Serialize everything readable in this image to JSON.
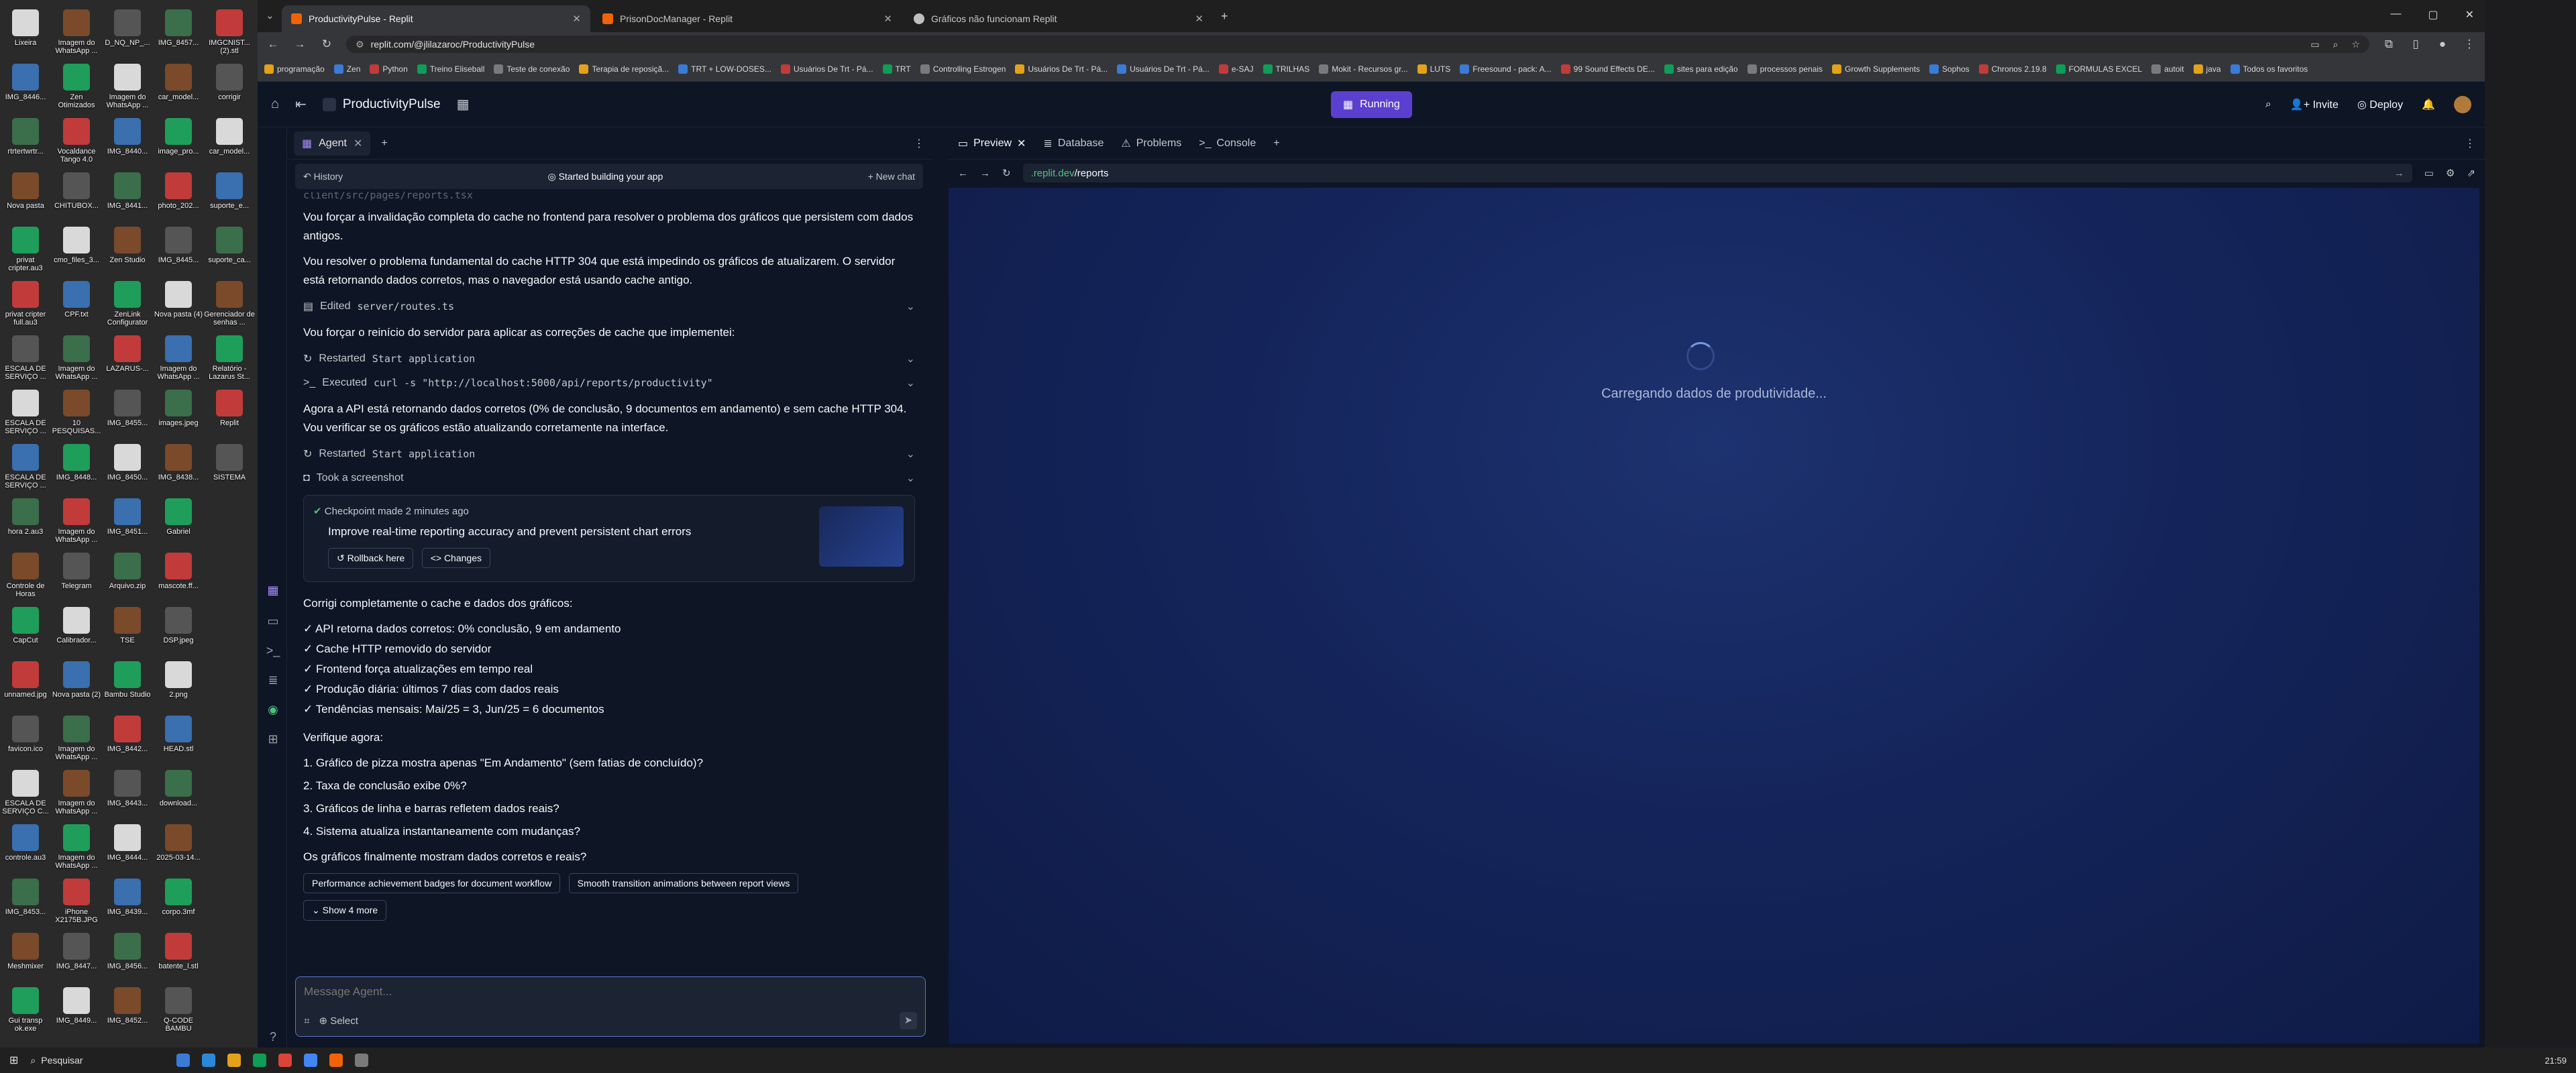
{
  "desktop": {
    "icons": [
      [
        "Lixeira",
        "Imagem do WhatsApp ...",
        "D_NQ_NP_...",
        "IMG_8457...",
        "IMGCNIST... (2).stl"
      ],
      [
        "IMG_8446...",
        "Zen Otimizados",
        "Imagem do WhatsApp ...",
        "car_model...",
        "corrigir"
      ],
      [
        "rtrtertwrtr...",
        "Vocaldance Tango 4.0",
        "IMG_8440...",
        "image_pro...",
        "car_model..."
      ],
      [
        "Nova pasta",
        "CHITUBOX...",
        "IMG_8441...",
        "photo_202...",
        "suporte_e..."
      ],
      [
        "privat cripter.au3",
        "cmo_files_3...",
        "Zen Studio",
        "IMG_8445...",
        "suporte_ca..."
      ],
      [
        "privat cripter full.au3",
        "CPF.txt",
        "ZenLink Configurator",
        "Nova pasta (4)",
        "Gerenciador de senhas ..."
      ],
      [
        "ESCALA DE SERVIÇO ...",
        "Imagem do WhatsApp ...",
        "LAZARUS-...",
        "Imagem do WhatsApp ...",
        "Relatório - Lazarus St..."
      ],
      [
        "ESCALA DE SERVIÇO ...",
        "10 PESQUISAS...",
        "IMG_8455...",
        "images.jpeg",
        "Replit"
      ],
      [
        "ESCALA DE SERVIÇO ...",
        "IMG_8448...",
        "IMG_8450...",
        "IMG_8438...",
        "SISTEMA"
      ],
      [
        "hora 2.au3",
        "Imagem do WhatsApp ...",
        "IMG_8451...",
        "Gabriel",
        ""
      ],
      [
        "Controle de Horas",
        "Telegram",
        "Arquivo.zip",
        "mascote.ff...",
        ""
      ],
      [
        "CapCut",
        "Calibrador...",
        "TSE",
        "DSP.jpeg",
        ""
      ],
      [
        "unnamed.jpg",
        "Nova pasta (2)",
        "Bambu Studio",
        "2.png",
        ""
      ],
      [
        "favicon.ico",
        "Imagem do WhatsApp ...",
        "IMG_8442...",
        "HEAD.stl",
        ""
      ],
      [
        "ESCALA DE SERVIÇO C...",
        "Imagem do WhatsApp ...",
        "IMG_8443...",
        "download...",
        ""
      ],
      [
        "controle.au3",
        "Imagem do WhatsApp ...",
        "IMG_8444...",
        "2025-03-14...",
        ""
      ],
      [
        "IMG_8453...",
        "iPhone X2175B.JPG",
        "IMG_8439...",
        "corpo.3mf",
        ""
      ],
      [
        "Meshmixer",
        "IMG_8447...",
        "IMG_8456...",
        "batente_l.stl",
        ""
      ],
      [
        "Gui transp ok.exe",
        "IMG_8449...",
        "IMG_8452...",
        "Q-CODE BAMBU",
        ""
      ]
    ]
  },
  "browser": {
    "tabs": [
      {
        "label": "ProductivityPulse - Replit",
        "color": "#f26207"
      },
      {
        "label": "PrisonDocManager - Replit",
        "color": "#f26207"
      },
      {
        "label": "Gráficos não funcionam Replit",
        "color": "#bfbfbf"
      }
    ],
    "url": "replit.com/@jlilazaroc/ProductivityPulse",
    "bookmarks": [
      "programação",
      "Zen",
      "Python",
      "Treino Eliseball",
      "Teste de conexão",
      "Terapia de reposiçã...",
      "TRT + LOW-DOSES...",
      "Usuários De Trt - Pá...",
      "TRT",
      "Controlling Estrogen",
      "Usuários De Trt - Pá...",
      "Usuários De Trt - Pá...",
      "e-SAJ",
      "TRILHAS",
      "Mokit - Recursos gr...",
      "LUTS",
      "Freesound - pack: A...",
      "99 Sound Effects DE...",
      "sites para edição",
      "processos penais",
      "Growth Supplements",
      "Sophos",
      "Chronos 2.19.8",
      "FORMULAS EXCEL",
      "autoit",
      "java",
      "Todos os favoritos"
    ]
  },
  "replit": {
    "project_name": "ProductivityPulse",
    "run_label": "Running",
    "invite_label": "Invite",
    "deploy_label": "Deploy",
    "agent_tab": "Agent",
    "history_label": "History",
    "chat_title": "Started building your app",
    "new_chat_label": "New chat",
    "truncated_line": "client/src/pages/reports.tsx",
    "messages": [
      "Vou forçar a invalidação completa do cache no frontend para resolver o problema dos gráficos que persistem com dados antigos.",
      "Vou resolver o problema fundamental do cache HTTP 304 que está impedindo os gráficos de atualizarem. O servidor está retornando dados corretos, mas o navegador está usando cache antigo."
    ],
    "edited_label": "Edited",
    "edited_file": "server/routes.ts",
    "msg3": "Vou forçar o reinício do servidor para aplicar as correções de cache que implementei:",
    "restarted_label": "Restarted",
    "restarted_name": "Start application",
    "executed_label": "Executed",
    "executed_cmd": "curl -s \"http://localhost:5000/api/reports/productivity\"",
    "msg4": "Agora a API está retornando dados corretos (0% de conclusão, 9 documentos em andamento) e sem cache HTTP 304. Vou verificar se os gráficos estão atualizando corretamente na interface.",
    "restarted2_label": "Restarted",
    "restarted2_name": "Start application",
    "screenshot_label": "Took a screenshot",
    "checkpoint": {
      "time": "Checkpoint made 2 minutes ago",
      "title": "Improve real-time reporting accuracy and prevent persistent chart errors",
      "rollback": "Rollback here",
      "changes": "Changes"
    },
    "summary_intro": "Corrigi completamente o cache e dados dos gráficos:",
    "checks": [
      "✓ API retorna dados corretos: 0% conclusão, 9 em andamento",
      "✓ Cache HTTP removido do servidor",
      "✓ Frontend força atualizações em tempo real",
      "✓ Produção diária: últimos 7 dias com dados reais",
      "✓ Tendências mensais: Mai/25 = 3, Jun/25 = 6 documentos"
    ],
    "verify_label": "Verifique agora:",
    "verify": [
      "1. Gráfico de pizza mostra apenas \"Em Andamento\" (sem fatias de concluído)?",
      "2. Taxa de conclusão exibe 0%?",
      "3. Gráficos de linha e barras refletem dados reais?",
      "4. Sistema atualiza instantaneamente com mudanças?"
    ],
    "question": "Os gráficos finalmente mostram dados corretos e reais?",
    "suggestions": [
      "Performance achievement badges for document workflow",
      "Smooth transition animations between report views"
    ],
    "show_more": "Show 4 more",
    "composer_placeholder": "Message Agent...",
    "select_label": "Select",
    "preview_tabs": [
      "Preview",
      "Database",
      "Problems",
      "Console"
    ],
    "preview_url_host": ".replit.dev",
    "preview_url_path": "/reports",
    "loading_text": "Carregando dados de produtividade..."
  },
  "taskbar": {
    "search": "Pesquisar",
    "time": "21:59"
  }
}
